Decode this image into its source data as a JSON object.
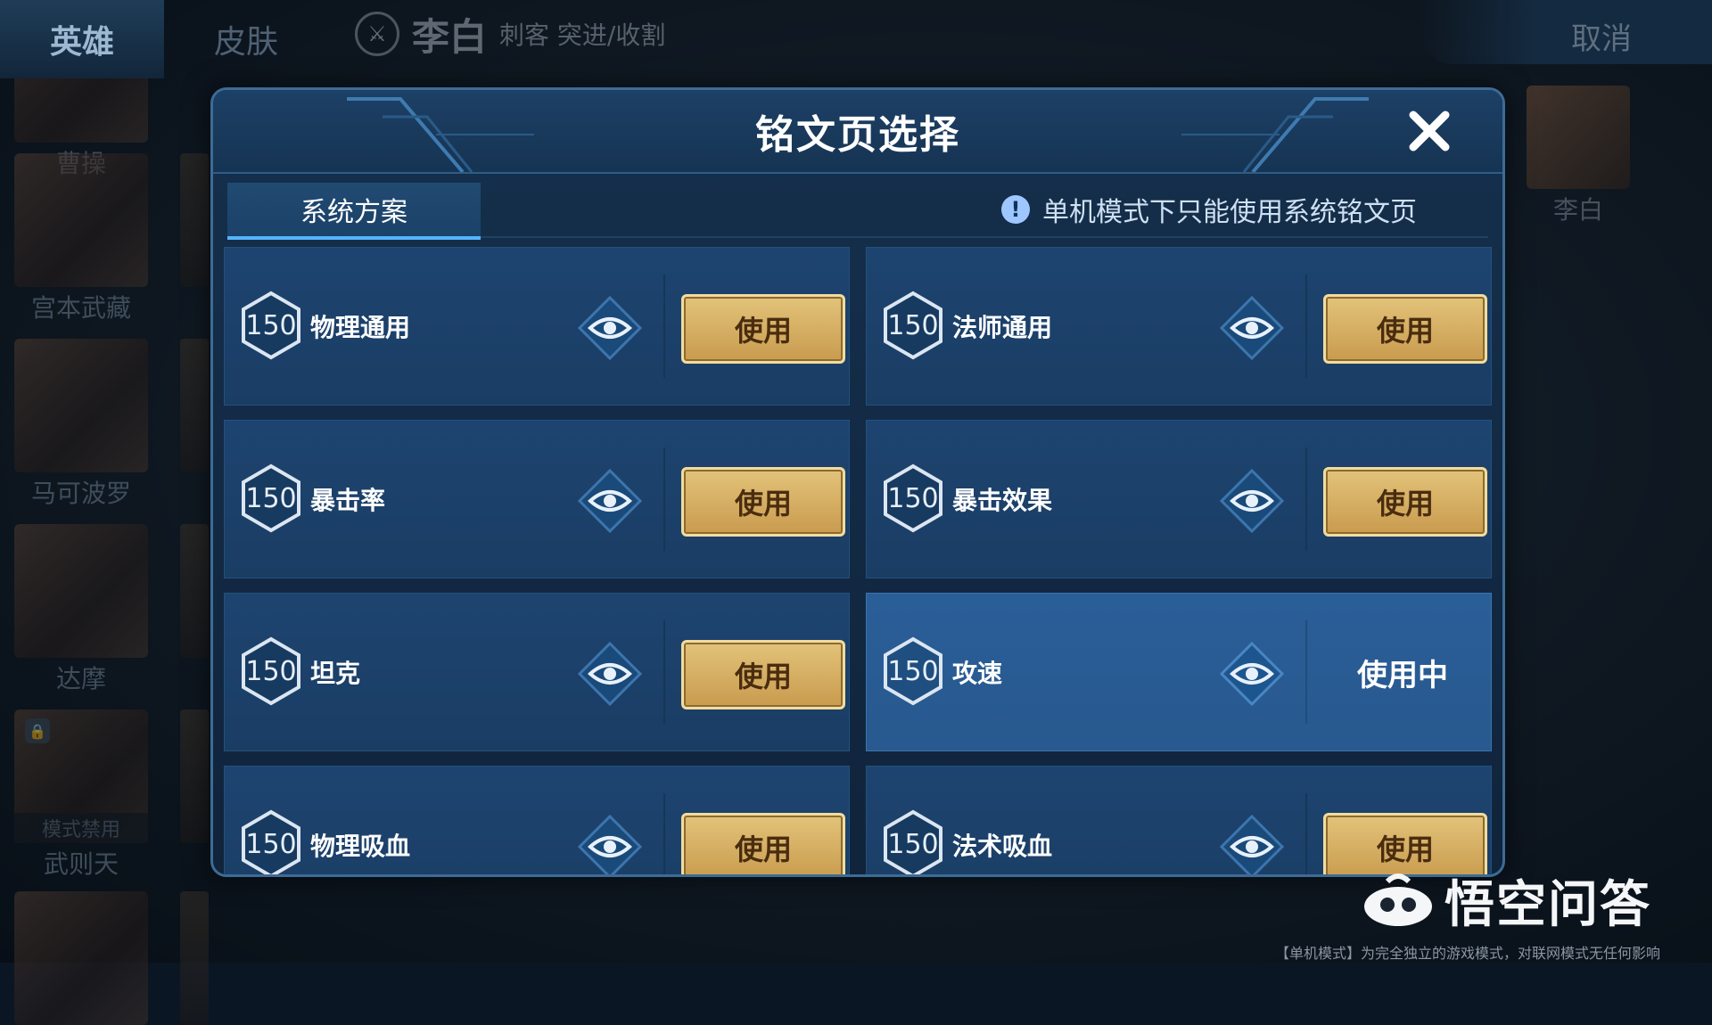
{
  "topbar": {
    "tab_hero": "英雄",
    "tab_skin": "皮肤",
    "hero_name": "李白",
    "hero_role": "刺客 突进/收割",
    "cancel": "取消"
  },
  "hero_list": {
    "items": [
      {
        "name": "曹操"
      },
      {
        "name": "宫本武藏"
      },
      {
        "name": "马可波罗"
      },
      {
        "name": "达摩"
      },
      {
        "name": "武则天",
        "banned_label": "模式禁用"
      }
    ]
  },
  "selected_hero": {
    "name": "李白"
  },
  "dialog": {
    "title": "铭文页选择",
    "tab_system": "系统方案",
    "notice": "单机模式下只能使用系统铭文页",
    "pages": [
      {
        "level": "150",
        "name": "物理通用",
        "action": "使用",
        "active": false
      },
      {
        "level": "150",
        "name": "法师通用",
        "action": "使用",
        "active": false
      },
      {
        "level": "150",
        "name": "暴击率",
        "action": "使用",
        "active": false
      },
      {
        "level": "150",
        "name": "暴击效果",
        "action": "使用",
        "active": false
      },
      {
        "level": "150",
        "name": "坦克",
        "action": "使用",
        "active": false
      },
      {
        "level": "150",
        "name": "攻速",
        "action": "使用中",
        "active": true
      },
      {
        "level": "150",
        "name": "物理吸血",
        "action": "使用",
        "active": false
      },
      {
        "level": "150",
        "name": "法术吸血",
        "action": "使用",
        "active": false
      }
    ]
  },
  "watermark": {
    "text": "悟空问答"
  },
  "footer_note": "【单机模式】为完全独立的游戏模式，对联网模式无任何影响",
  "colors": {
    "accent": "#55b4ff",
    "button_gold": "#d6ad5f",
    "dialog_bg": "#15304d"
  }
}
